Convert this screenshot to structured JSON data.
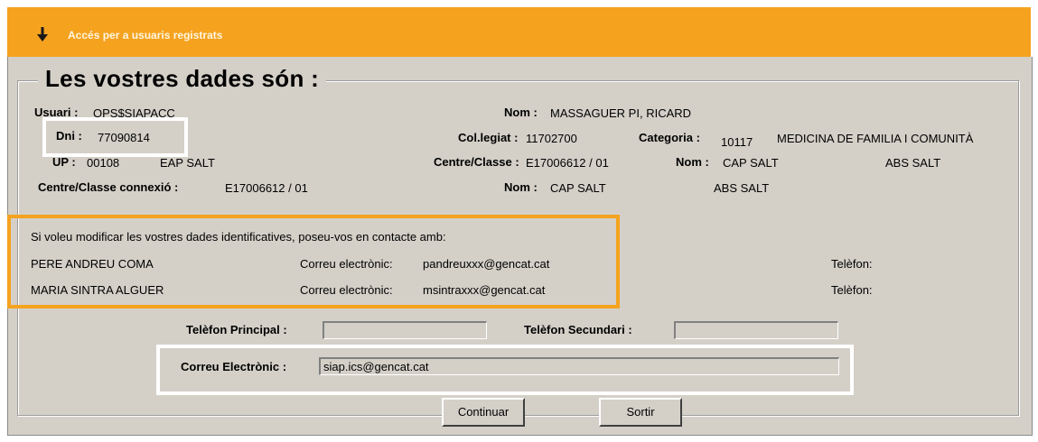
{
  "header": {
    "title": "Accés per a usuaris registrats",
    "icon": "down-arrow-icon"
  },
  "legend": "Les vostres dades són :",
  "user": {
    "usuari_label": "Usuari :",
    "usuari_value": "OPS$SIAPACC",
    "dni_label": "Dni :",
    "dni_value": "77090814",
    "up_label": "UP :",
    "up_value": "00108",
    "up_name": "EAP SALT",
    "ccc_label": "Centre/Classe connexió :",
    "ccc_value": "E17006612  / 01",
    "nom_label": "Nom :",
    "nom_value": "MASSAGUER PI, RICARD",
    "col_label": "Col.legiat :",
    "col_value": "11702700",
    "cat_label": "Categoria :",
    "cat_code": "10117",
    "cat_name": "MEDICINA DE FAMILIA I COMUNITÀ",
    "cc_label": "Centre/Classe :",
    "cc_value": "E17006612 / 01",
    "nom2_label": "Nom :",
    "nom2_value": "CAP SALT",
    "nom2_abs": "ABS SALT",
    "nom3_label": "Nom :",
    "nom3_value": "CAP SALT",
    "nom3_abs": "ABS SALT"
  },
  "contact": {
    "intro": "Si voleu modificar les vostres dades identificatives, poseu-vos en contacte amb:",
    "people": [
      {
        "name": "PERE ANDREU COMA",
        "email_label": "Correu electrònic:",
        "email": "pandreuxxx@gencat.cat",
        "phone_label": "Telèfon:"
      },
      {
        "name": "MARIA SINTRA ALGUER",
        "email_label": "Correu electrònic:",
        "email": "msintraxxx@gencat.cat",
        "phone_label": "Telèfon:"
      }
    ]
  },
  "form": {
    "tel_principal_label": "Telèfon Principal :",
    "tel_principal_value": "",
    "tel_secundari_label": "Telèfon Secundari :",
    "tel_secundari_value": "",
    "email_label": "Correu Electrònic :",
    "email_value": "siap.ics@gencat.cat"
  },
  "buttons": {
    "continue_label": "Continuar",
    "exit_label": "Sortir"
  },
  "colors": {
    "accent": "#f5a21f",
    "panel": "#d4d0c8"
  }
}
